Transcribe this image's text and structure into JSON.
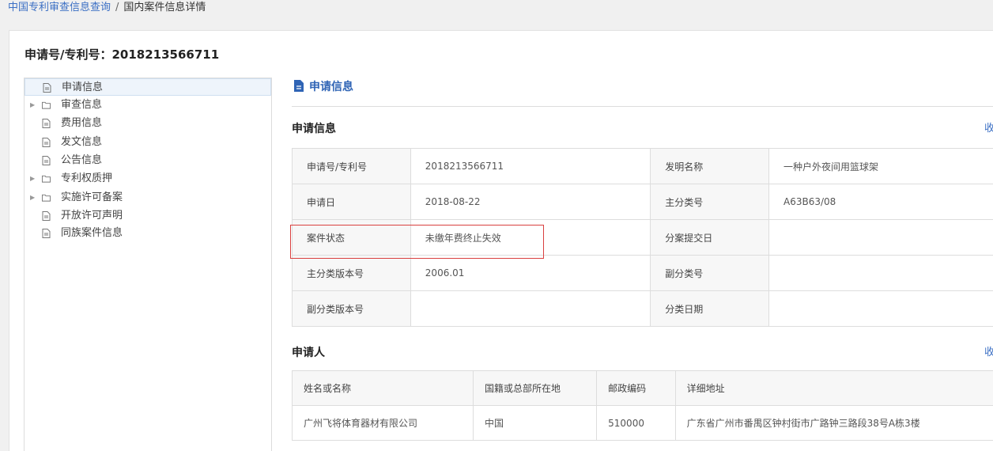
{
  "breadcrumb": {
    "root": "中国专利审查信息查询",
    "separator": "/",
    "current": "国内案件信息详情"
  },
  "page": {
    "title": "申请号/专利号：2018213566711"
  },
  "sidebar": {
    "items": [
      {
        "label": "申请信息",
        "icon": "document-icon",
        "expandable": false,
        "active": true
      },
      {
        "label": "审查信息",
        "icon": "folder-icon",
        "expandable": true,
        "active": false
      },
      {
        "label": "费用信息",
        "icon": "document-icon",
        "expandable": false,
        "active": false
      },
      {
        "label": "发文信息",
        "icon": "document-icon",
        "expandable": false,
        "active": false
      },
      {
        "label": "公告信息",
        "icon": "document-icon",
        "expandable": false,
        "active": false
      },
      {
        "label": "专利权质押",
        "icon": "folder-icon",
        "expandable": true,
        "active": false
      },
      {
        "label": "实施许可备案",
        "icon": "folder-icon",
        "expandable": true,
        "active": false
      },
      {
        "label": "开放许可声明",
        "icon": "document-icon",
        "expandable": false,
        "active": false
      },
      {
        "label": "同族案件信息",
        "icon": "document-icon",
        "expandable": false,
        "active": false
      }
    ]
  },
  "content": {
    "section_title": "申请信息",
    "collapse_label": "收",
    "application_info": {
      "title": "申请信息",
      "rows": [
        {
          "l1": "申请号/专利号",
          "v1": "2018213566711",
          "l2": "发明名称",
          "v2": "一种户外夜间用篮球架"
        },
        {
          "l1": "申请日",
          "v1": "2018-08-22",
          "l2": "主分类号",
          "v2": "A63B63/08"
        },
        {
          "l1": "案件状态",
          "v1": "未缴年费终止失效",
          "l2": "分案提交日",
          "v2": ""
        },
        {
          "l1": "主分类版本号",
          "v1": "2006.01",
          "l2": "副分类号",
          "v2": ""
        },
        {
          "l1": "副分类版本号",
          "v1": "",
          "l2": "分类日期",
          "v2": ""
        }
      ]
    },
    "applicant": {
      "title": "申请人",
      "headers": [
        "姓名或名称",
        "国籍或总部所在地",
        "邮政编码",
        "详细地址"
      ],
      "rows": [
        [
          "广州飞将体育器材有限公司",
          "中国",
          "510000",
          "广东省广州市番禺区钟村街市广路钟三路段38号A栋3楼"
        ]
      ]
    }
  },
  "colors": {
    "link": "#3b6fc4",
    "highlight": "#d9403f",
    "active_bg": "#eef4fb"
  }
}
